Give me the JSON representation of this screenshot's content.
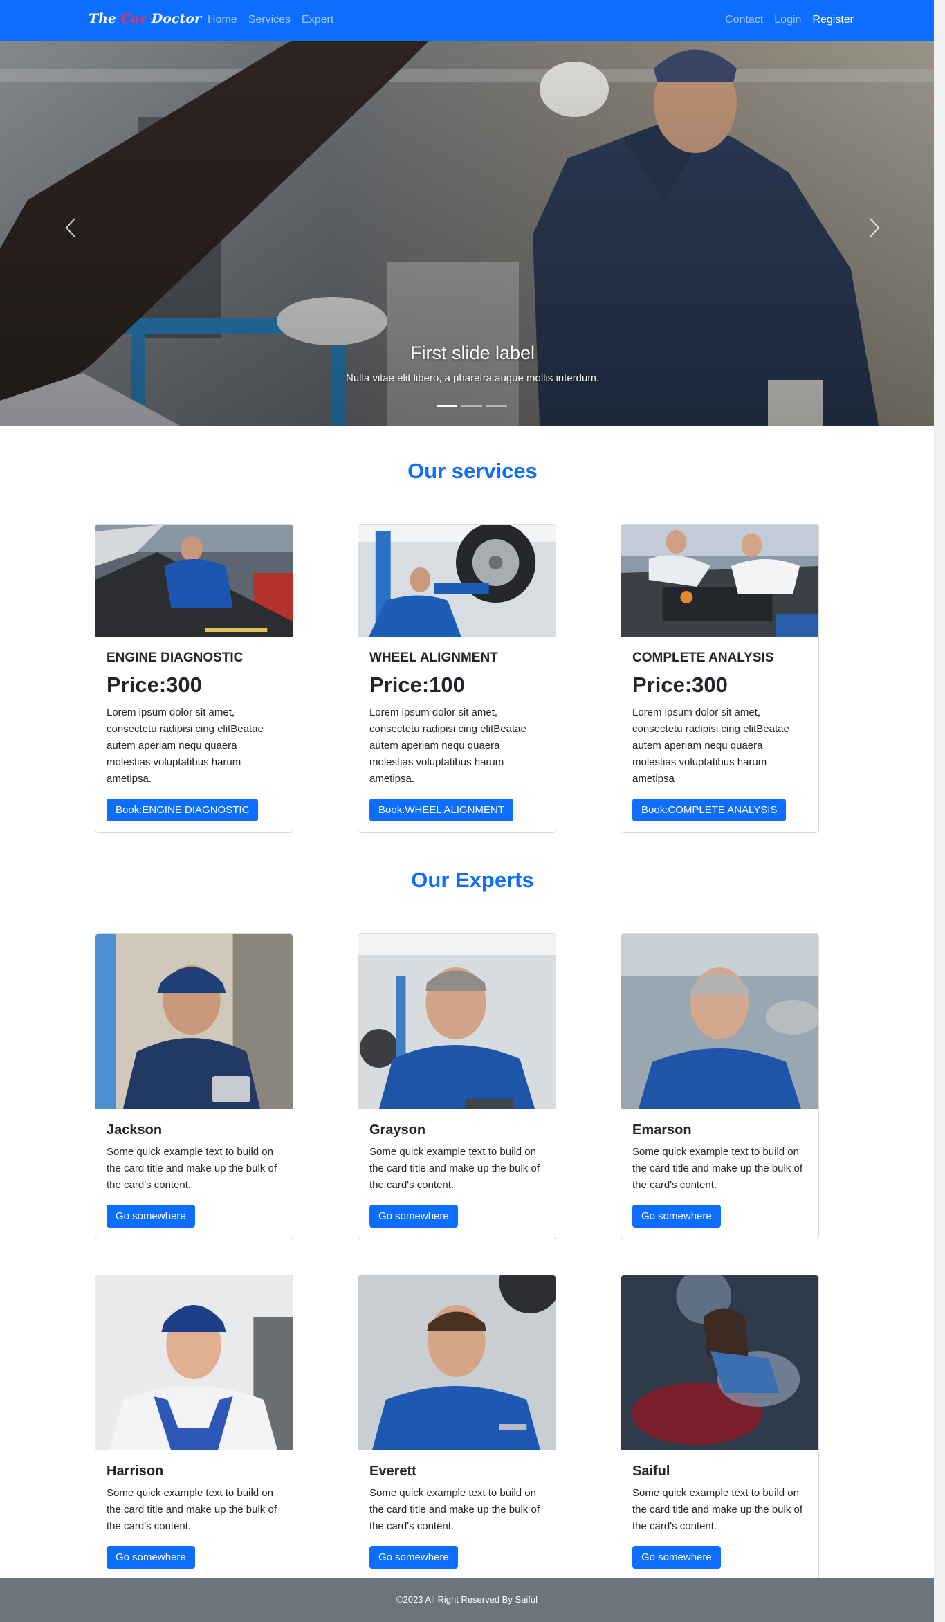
{
  "nav": {
    "brand_left": "The",
    "brand_mid": "Car",
    "brand_right": "Doctor",
    "left_links": [
      "Home",
      "Services",
      "Expert"
    ],
    "right_links": [
      "Contact",
      "Login",
      "Register"
    ]
  },
  "carousel": {
    "title": "First slide label",
    "text": "Nulla vitae elit libero, a pharetra augue mollis interdum.",
    "slide_count": 3,
    "active_slide": 1
  },
  "services": {
    "heading": "Our services",
    "items": [
      {
        "title": "ENGINE DIAGNOSTIC",
        "price": "Price:300",
        "text": "Lorem ipsum dolor sit amet, consectetu radipisi cing elitBeatae autem aperiam nequ quaera molestias voluptatibus harum ametipsa.",
        "button": "Book:ENGINE DIAGNOSTIC"
      },
      {
        "title": "WHEEL ALIGNMENT",
        "price": "Price:100",
        "text": "Lorem ipsum dolor sit amet, consectetu radipisi cing elitBeatae autem aperiam nequ quaera molestias voluptatibus harum ametipsa.",
        "button": "Book:WHEEL ALIGNMENT"
      },
      {
        "title": "COMPLETE ANALYSIS",
        "price": "Price:300",
        "text": "Lorem ipsum dolor sit amet, consectetu radipisi cing elitBeatae autem aperiam nequ quaera molestias voluptatibus harum ametipsa",
        "button": "Book:COMPLETE ANALYSIS"
      }
    ]
  },
  "experts": {
    "heading": "Our Experts",
    "items": [
      {
        "name": "Jackson",
        "text": "Some quick example text to build on the card title and make up the bulk of the card's content.",
        "button": "Go somewhere"
      },
      {
        "name": "Grayson",
        "text": "Some quick example text to build on the card title and make up the bulk of the card's content.",
        "button": "Go somewhere"
      },
      {
        "name": "Emarson",
        "text": "Some quick example text to build on the card title and make up the bulk of the card's content.",
        "button": "Go somewhere"
      },
      {
        "name": "Harrison",
        "text": "Some quick example text to build on the card title and make up the bulk of the card's content.",
        "button": "Go somewhere"
      },
      {
        "name": "Everett",
        "text": "Some quick example text to build on the card title and make up the bulk of the card's content.",
        "button": "Go somewhere"
      },
      {
        "name": "Saiful",
        "text": "Some quick example text to build on the card title and make up the bulk of the card's content.",
        "button": "Go somewhere"
      }
    ]
  },
  "footer": {
    "text": "©2023 All Right Reserved By Saiful"
  },
  "colors": {
    "primary": "#0d6efd",
    "footer_bg": "#6c757d",
    "brand_accent": "#e8335a"
  },
  "icons": [
    "chevron-left-icon",
    "chevron-right-icon"
  ]
}
